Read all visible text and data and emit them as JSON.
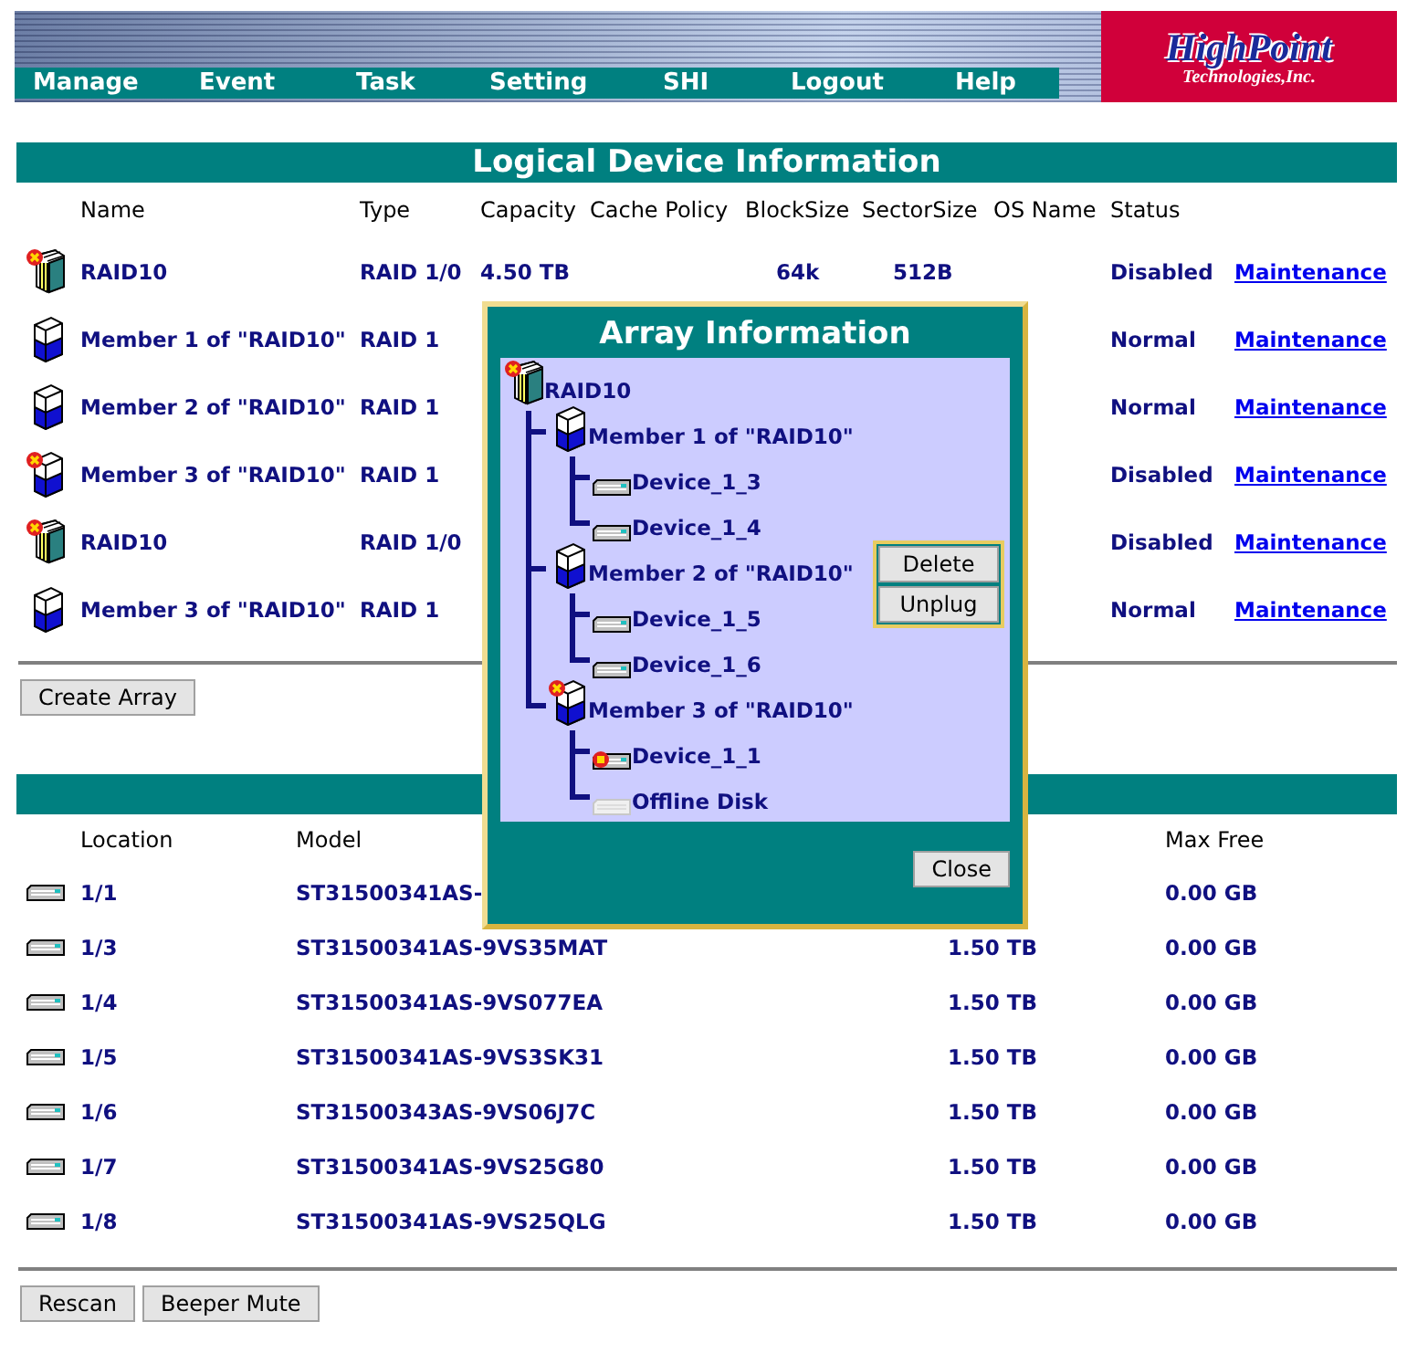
{
  "nav": {
    "items": [
      "Manage",
      "Event",
      "Task",
      "Setting",
      "SHI",
      "Logout",
      "Help"
    ],
    "logo": {
      "name": "HighPoint",
      "sub": "Technologies,Inc."
    }
  },
  "logical": {
    "title": "Logical Device Information",
    "columns": [
      "Name",
      "Type",
      "Capacity",
      "Cache Policy",
      "BlockSize",
      "SectorSize",
      "OS Name",
      "Status"
    ],
    "rows": [
      {
        "kind": "array",
        "failed": true,
        "name": "RAID10",
        "type": "RAID 1/0",
        "capacity": "4.50 TB",
        "blocksize": "64k",
        "sectorsize": "512B",
        "status": "Disabled",
        "action": "Maintenance"
      },
      {
        "kind": "member",
        "failed": false,
        "name": "Member 1 of \"RAID10\"",
        "type": "RAID 1",
        "status": "Normal",
        "action": "Maintenance"
      },
      {
        "kind": "member",
        "failed": false,
        "name": "Member 2 of \"RAID10\"",
        "type": "RAID 1",
        "status": "Normal",
        "action": "Maintenance"
      },
      {
        "kind": "member",
        "failed": true,
        "name": "Member 3 of \"RAID10\"",
        "type": "RAID 1",
        "status": "Disabled",
        "action": "Maintenance"
      },
      {
        "kind": "array",
        "failed": true,
        "name": "RAID10",
        "type": "RAID 1/0",
        "status": "Disabled",
        "action": "Maintenance"
      },
      {
        "kind": "member",
        "failed": false,
        "name": "Member 3 of \"RAID10\"",
        "type": "RAID 1",
        "status": "Normal",
        "action": "Maintenance"
      }
    ],
    "buttons": [
      "Create Array"
    ]
  },
  "physical": {
    "columns": [
      "Location",
      "Model",
      null,
      "Max Free"
    ],
    "rows": [
      {
        "location": "1/1",
        "model": "ST31500341AS-",
        "max_free": "0.00 GB"
      },
      {
        "location": "1/3",
        "model": "ST31500341AS-9VS35MAT",
        "capacity": "1.50 TB",
        "max_free": "0.00 GB"
      },
      {
        "location": "1/4",
        "model": "ST31500341AS-9VS077EA",
        "capacity": "1.50 TB",
        "max_free": "0.00 GB"
      },
      {
        "location": "1/5",
        "model": "ST31500341AS-9VS3SK31",
        "capacity": "1.50 TB",
        "max_free": "0.00 GB"
      },
      {
        "location": "1/6",
        "model": "ST31500343AS-9VS06J7C",
        "capacity": "1.50 TB",
        "max_free": "0.00 GB"
      },
      {
        "location": "1/7",
        "model": "ST31500341AS-9VS25G80",
        "capacity": "1.50 TB",
        "max_free": "0.00 GB"
      },
      {
        "location": "1/8",
        "model": "ST31500341AS-9VS25QLG",
        "capacity": "1.50 TB",
        "max_free": "0.00 GB"
      }
    ],
    "buttons": [
      "Rescan",
      "Beeper Mute"
    ]
  },
  "dialog": {
    "title": "Array Information",
    "tree": [
      {
        "kind": "array",
        "failed": true,
        "label": "RAID10",
        "children": [
          {
            "kind": "member",
            "failed": false,
            "label": "Member 1 of \"RAID10\"",
            "children": [
              {
                "kind": "disk",
                "warning": false,
                "label": "Device_1_3"
              },
              {
                "kind": "disk",
                "warning": false,
                "label": "Device_1_4"
              }
            ]
          },
          {
            "kind": "member",
            "failed": false,
            "label": "Member 2 of \"RAID10\"",
            "children": [
              {
                "kind": "disk",
                "warning": false,
                "label": "Device_1_5"
              },
              {
                "kind": "disk",
                "warning": false,
                "label": "Device_1_6"
              }
            ]
          },
          {
            "kind": "member",
            "failed": true,
            "label": "Member 3 of \"RAID10\"",
            "children": [
              {
                "kind": "disk",
                "warning": true,
                "label": "Device_1_1"
              },
              {
                "kind": "offline",
                "label": "Offline Disk"
              }
            ]
          }
        ]
      }
    ],
    "menu": [
      "Delete",
      "Unplug"
    ],
    "close": "Close"
  }
}
